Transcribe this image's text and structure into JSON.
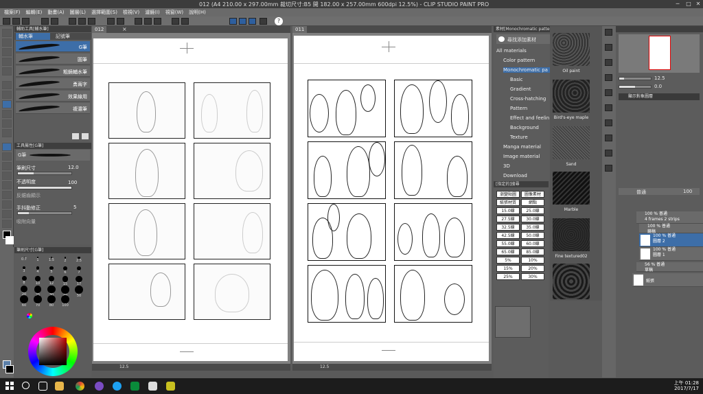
{
  "window": {
    "title": "012 (A4 210.00 x 297.00mm 裁切尺寸:B5 開 182.00 x 257.00mm 600dpi 12.5%) - CLIP STUDIO PAINT PRO"
  },
  "menu": [
    "檔案(F)",
    "編輯(E)",
    "動畫(A)",
    "圖層(L)",
    "選擇範圍(S)",
    "檢視(V)",
    "濾鏡(I)",
    "視窗(W)",
    "說明(H)"
  ],
  "subtool": {
    "tabs": [
      "輔水筆",
      "記號筆"
    ],
    "brushes": [
      "G筆",
      "圓筆",
      "粗鏡輔水筆",
      "勇兩字",
      "效果線用",
      "複濃筆"
    ]
  },
  "toolprop": {
    "title": "工具屬性[G筆]",
    "brush_name": "G筆",
    "size_label": "筆刷尺寸",
    "size_value": "12.0",
    "opacity_label": "不透明度",
    "opacity_value": "100",
    "aa_label": "反鋸齒顯示",
    "stab_label": "手抖動修正",
    "stab_value": "5",
    "vector_label": "吸附向量"
  },
  "brushsize": {
    "title": "筆刷尺寸[G筆]",
    "sizes": [
      "0.7",
      "1",
      "1.5",
      "2",
      "2.5",
      "3",
      "4",
      "5",
      "6",
      "7",
      "8",
      "10",
      "12",
      "15",
      "17",
      "20",
      "25",
      "30",
      "40",
      "50",
      "60",
      "70",
      "80",
      "100"
    ]
  },
  "docs": {
    "left_tab": "012",
    "right_tab": "011",
    "left_zoom": "12.5",
    "right_zoom": "12.5"
  },
  "materials": {
    "title": "素材[Monochromatic pattern]",
    "search_label": "尋找添加素材",
    "tree": [
      "All materials",
      "Color pattern",
      "Monochromatic pa",
      "Basic",
      "Gradient",
      "Cross-hatching",
      "Pattern",
      "Effect and feelin",
      "Background",
      "Texture",
      "Manga material",
      "Image material",
      "3D",
      "Download"
    ],
    "textures": [
      "Oil paint",
      "Bird's-eye maple",
      "Sand",
      "Marble",
      "Fine textured02",
      ""
    ]
  },
  "search": {
    "title": "[指定的]搜尋",
    "tags": [
      "漸變貼圖",
      "圖像素材",
      "紙張材質",
      "網點",
      "15.0線",
      "25.0線",
      "27.5線",
      "30.0線",
      "32.5線",
      "35.0線",
      "42.5線",
      "50.0線",
      "55.0線",
      "60.0線",
      "65.0線",
      "85.0線",
      "5%",
      "10%",
      "15%",
      "20%",
      "25%",
      "30%"
    ]
  },
  "layers": {
    "blend": "普通",
    "opacity": "100",
    "title": "顯示對象圖層",
    "rows": [
      {
        "name": "100 % 普通",
        "sub": "4 frames 2 strips"
      },
      {
        "name": "100 % 普通",
        "sub": "鏡稿"
      },
      {
        "name": "100 % 普通",
        "sub": "圖層 2"
      },
      {
        "name": "100 % 普通",
        "sub": "圖層 1"
      },
      {
        "name": "56 % 普通",
        "sub": "草稿"
      },
      {
        "name": "",
        "sub": "紙張"
      }
    ]
  },
  "navigator": {
    "zoom": "12.5",
    "angle": "0.0"
  },
  "clock": {
    "time": "上午 01:28",
    "date": "2017/7/17"
  },
  "colors": {
    "accent": "#3d6ea8",
    "panel": "#5c5c5c"
  }
}
